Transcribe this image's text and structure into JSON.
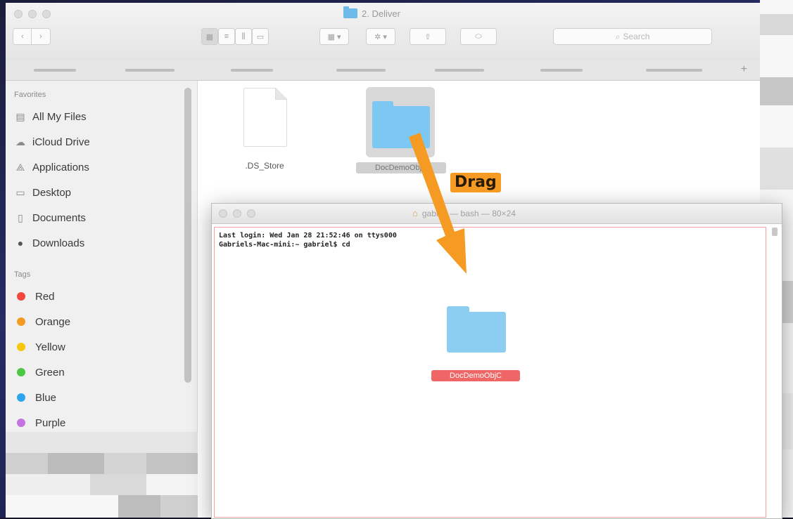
{
  "finder": {
    "title": "2. Deliver",
    "search_placeholder": "Search",
    "nav_back": "‹",
    "nav_forward": "›",
    "new_tab": "+",
    "sidebar": {
      "favorites_heading": "Favorites",
      "items": [
        {
          "label": "All My Files",
          "icon": "all-files-icon"
        },
        {
          "label": "iCloud Drive",
          "icon": "cloud-icon"
        },
        {
          "label": "Applications",
          "icon": "applications-icon"
        },
        {
          "label": "Desktop",
          "icon": "desktop-icon"
        },
        {
          "label": "Documents",
          "icon": "documents-icon"
        },
        {
          "label": "Downloads",
          "icon": "downloads-icon"
        }
      ],
      "tags_heading": "Tags",
      "tags": [
        {
          "label": "Red",
          "color": "#f0473f"
        },
        {
          "label": "Orange",
          "color": "#f59a23"
        },
        {
          "label": "Yellow",
          "color": "#f3c80e"
        },
        {
          "label": "Green",
          "color": "#4cc745"
        },
        {
          "label": "Blue",
          "color": "#2ea4ec"
        },
        {
          "label": "Purple",
          "color": "#c374e2"
        }
      ]
    },
    "files": [
      {
        "name": ".DS_Store"
      },
      {
        "name": "DocDemoObjC"
      }
    ]
  },
  "terminal": {
    "title": "gabriel — bash — 80×24",
    "lines": [
      "Last login: Wed Jan 28 21:52:46 on ttys000",
      "Gabriels-Mac-mini:~ gabriel$ cd "
    ],
    "dragged_folder_label": "DocDemoObjC"
  },
  "annotation": {
    "drag_label": "Drag",
    "arrow_color": "#f59a23"
  }
}
